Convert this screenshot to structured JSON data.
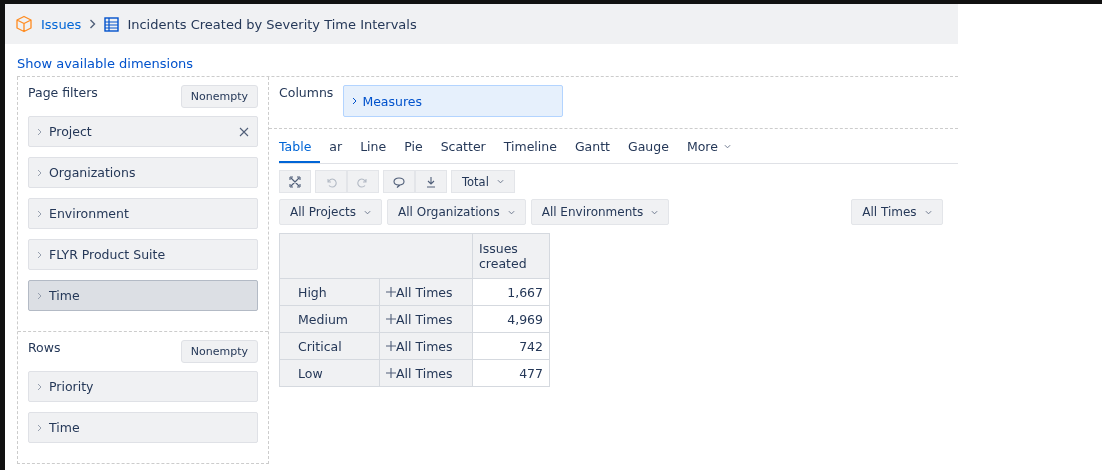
{
  "breadcrumb": {
    "parent": "Issues",
    "title": "Incidents Created by Severity Time Intervals"
  },
  "show_dimensions_link": "Show available dimensions",
  "page_filters": {
    "label": "Page filters",
    "button": "Nonempty",
    "items": [
      {
        "label": "Project",
        "selected": false,
        "removable": true
      },
      {
        "label": "Organizations",
        "selected": false,
        "removable": false
      },
      {
        "label": "Environment",
        "selected": false,
        "removable": false
      },
      {
        "label": "FLYR Product Suite",
        "selected": false,
        "removable": false
      },
      {
        "label": "Time",
        "selected": true,
        "removable": false
      }
    ]
  },
  "rows": {
    "label": "Rows",
    "button": "Nonempty",
    "items": [
      {
        "label": "Priority",
        "selected": false,
        "removable": false
      },
      {
        "label": "Time",
        "selected": false,
        "removable": false
      }
    ]
  },
  "columns": {
    "label": "Columns",
    "items": [
      {
        "label": "Measures"
      }
    ]
  },
  "tabs": [
    {
      "label": "Table",
      "selected": true
    },
    {
      "label": "ar",
      "selected": false
    },
    {
      "label": "Line",
      "selected": false
    },
    {
      "label": "Pie",
      "selected": false
    },
    {
      "label": "Scatter",
      "selected": false
    },
    {
      "label": "Timeline",
      "selected": false
    },
    {
      "label": "Gantt",
      "selected": false
    },
    {
      "label": "Gauge",
      "selected": false
    },
    {
      "label": "More",
      "selected": false,
      "dropdown": true
    }
  ],
  "toolbar": {
    "total_button": "Total"
  },
  "filters": [
    {
      "label": "All Projects"
    },
    {
      "label": "All Organizations"
    },
    {
      "label": "All Environments"
    },
    {
      "kind": "gap"
    },
    {
      "label": "All Times"
    }
  ],
  "table": {
    "column_header": "Issues created",
    "rows": [
      {
        "name": "High",
        "member": "All Times",
        "value": "1,667"
      },
      {
        "name": "Medium",
        "member": "All Times",
        "value": "4,969"
      },
      {
        "name": "Critical",
        "member": "All Times",
        "value": "742"
      },
      {
        "name": "Low",
        "member": "All Times",
        "value": "477"
      }
    ]
  }
}
